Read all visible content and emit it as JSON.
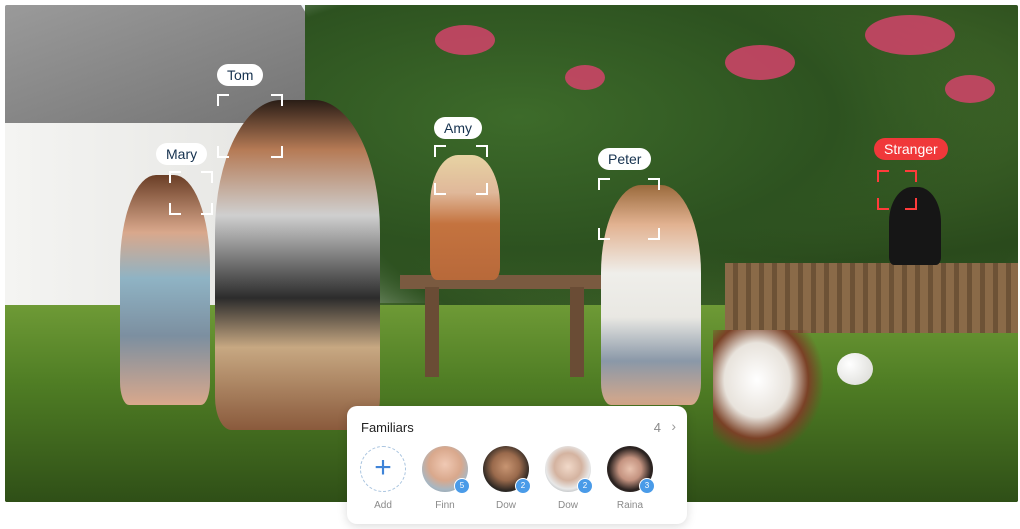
{
  "face_tags": [
    {
      "name": "Tom",
      "style": "known"
    },
    {
      "name": "Mary",
      "style": "known"
    },
    {
      "name": "Amy",
      "style": "known"
    },
    {
      "name": "Peter",
      "style": "known"
    },
    {
      "name": "Stranger",
      "style": "stranger"
    }
  ],
  "colors": {
    "tag_text": "#16324f",
    "stranger": "#f0383a",
    "accent": "#4a9be8"
  },
  "familiars_panel": {
    "title": "Familiars",
    "count": "4",
    "chevron_icon": "chevron-right-icon",
    "members": [
      {
        "label": "Add",
        "icon": "plus-icon"
      },
      {
        "label": "Finn",
        "badge": "5"
      },
      {
        "label": "Dow",
        "badge": "2"
      },
      {
        "label": "Dow",
        "badge": "2"
      },
      {
        "label": "Raina",
        "badge": "3"
      }
    ]
  }
}
